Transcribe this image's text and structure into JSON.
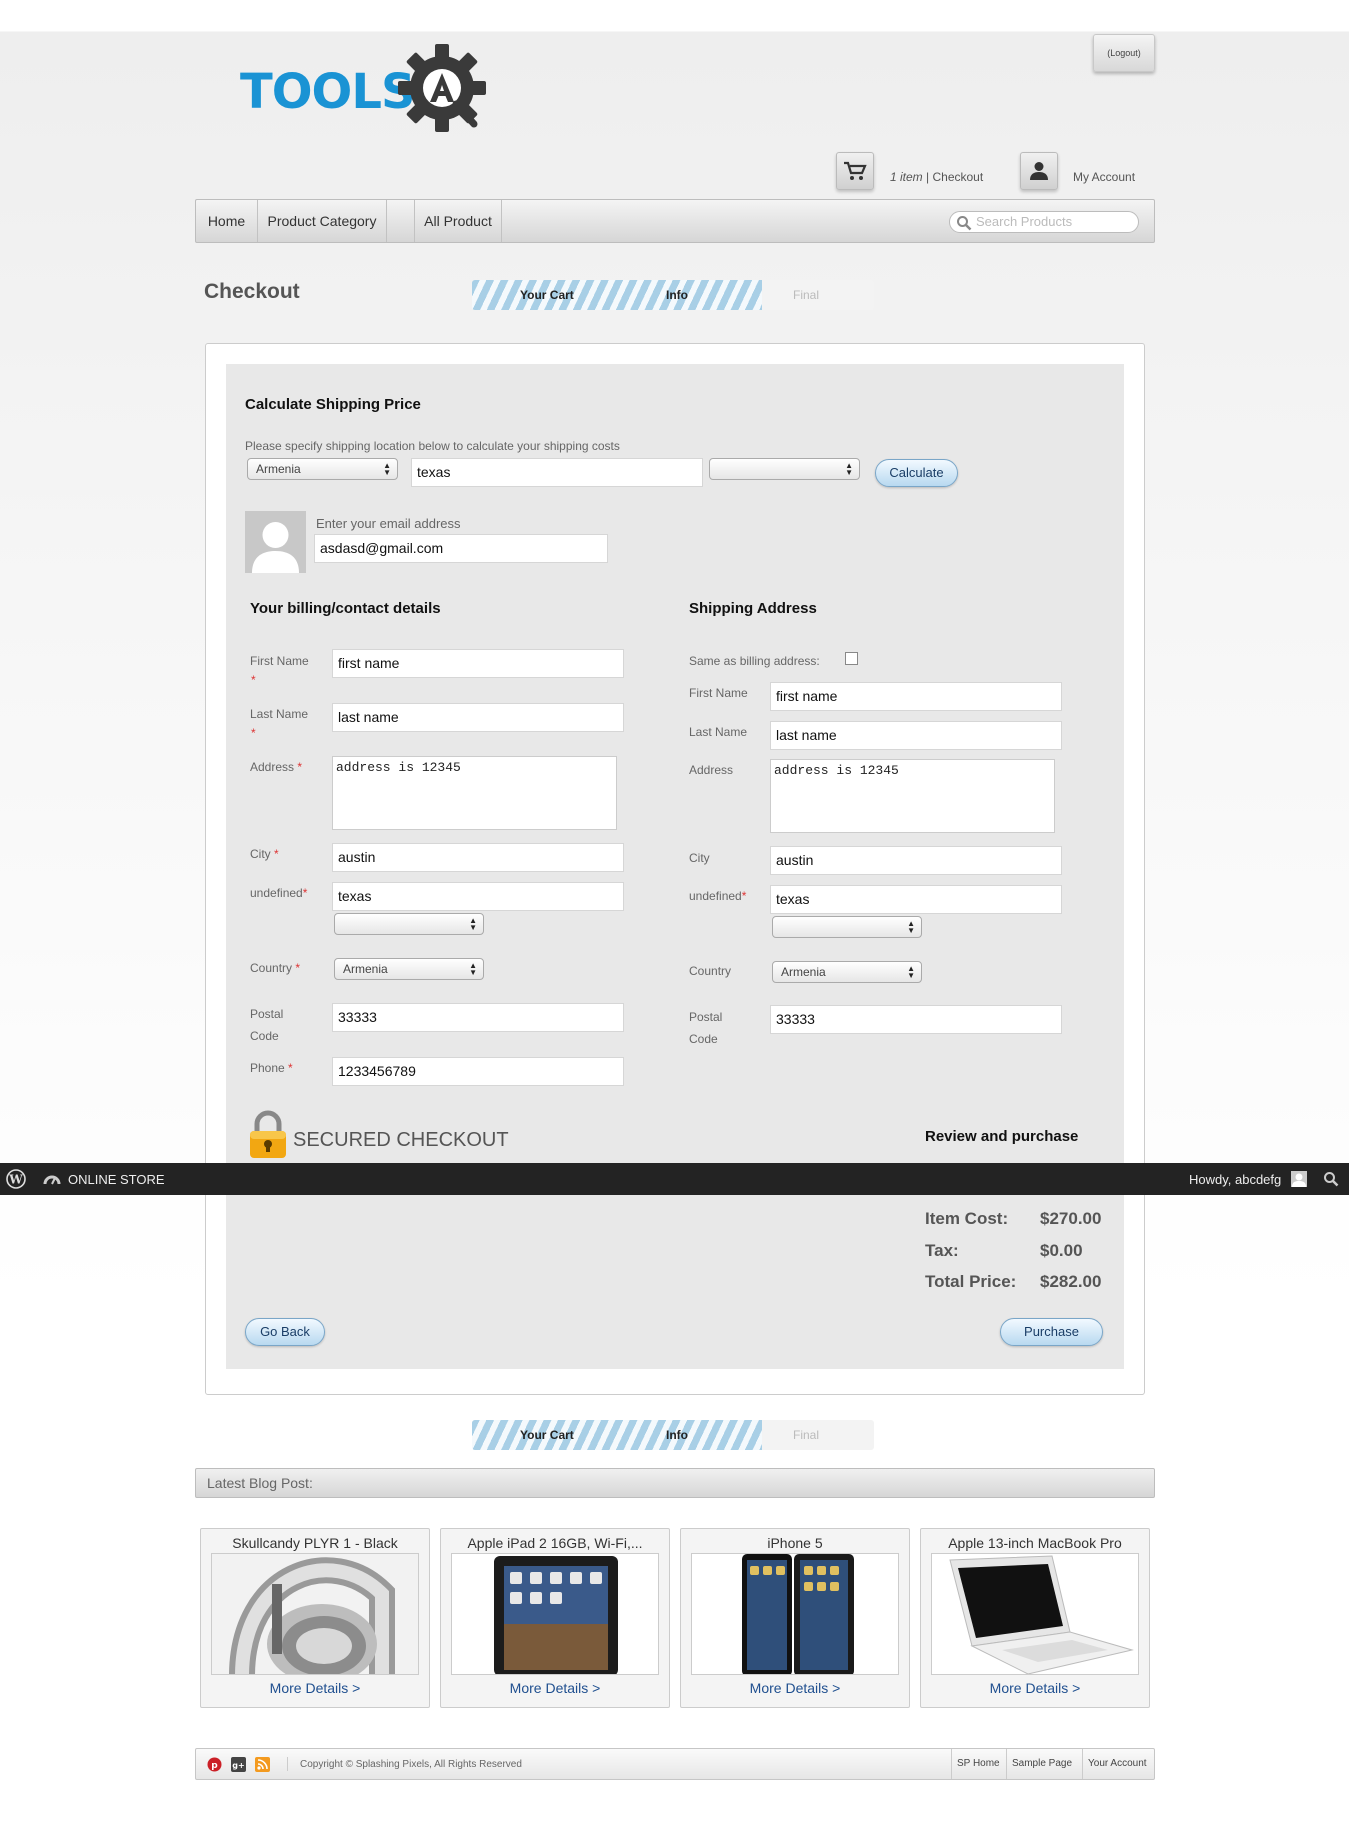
{
  "header": {
    "logo_text": "TOOLS",
    "logout_label": "(Logout)",
    "cart_count": "1 item",
    "cart_link": " | Checkout",
    "account_label": "My Account"
  },
  "nav": {
    "items": [
      "Home",
      "Product Category",
      "All Product"
    ],
    "search_placeholder": "Search Products"
  },
  "checkout": {
    "title": "Checkout",
    "progress": [
      "Your Cart",
      "Info",
      "Final"
    ]
  },
  "shipping_calc": {
    "title": "Calculate Shipping Price",
    "hint": "Please specify shipping location below to calculate your shipping costs",
    "country": "Armenia",
    "region": "texas",
    "state": "",
    "button": "Calculate"
  },
  "email": {
    "label": "Enter your email address",
    "value": "asdasd@gmail.com"
  },
  "billing": {
    "title": "Your billing/contact details",
    "first_name_label": "First Name",
    "first_name": "first name",
    "last_name_label": "Last Name",
    "last_name": "last name",
    "address_label": "Address",
    "address": "address is 12345",
    "city_label": "City",
    "city": "austin",
    "state_label": "undefined",
    "state": "texas",
    "state_select": "",
    "country_label": "Country",
    "country": "Armenia",
    "postal_label_1": "Postal",
    "postal_label_2": "Code",
    "postal": "33333",
    "phone_label": "Phone",
    "phone": "1233456789",
    "required_mark": "*"
  },
  "shipping": {
    "title": "Shipping Address",
    "same_label": "Same as billing address:",
    "first_name_label": "First Name",
    "first_name": "first name",
    "last_name_label": "Last Name",
    "last_name": "last name",
    "address_label": "Address",
    "address": "address is 12345",
    "city_label": "City",
    "city": "austin",
    "state_label": "undefined",
    "state": "texas",
    "state_select": "",
    "country_label": "Country",
    "country": "Armenia",
    "postal_label_1": "Postal",
    "postal_label_2": "Code",
    "postal": "33333"
  },
  "secured": "SECURED CHECKOUT",
  "review": {
    "title": "Review and purchase",
    "item_cost_label": "Item Cost:",
    "item_cost": "$270.00",
    "tax_label": "Tax:",
    "tax": "$0.00",
    "total_label": "Total Price:",
    "total": "$282.00"
  },
  "buttons": {
    "go_back": "Go Back",
    "purchase": "Purchase"
  },
  "wp_admin_bar": {
    "site_name": "ONLINE STORE",
    "greeting": "Howdy, abcdefg"
  },
  "blog": {
    "title": "Latest Blog Post:",
    "products": [
      {
        "name": "Skullcandy PLYR 1 - Black",
        "link": "More Details >"
      },
      {
        "name": "Apple iPad 2 16GB, Wi-Fi,...",
        "link": "More Details >"
      },
      {
        "name": "iPhone 5",
        "link": "More Details >"
      },
      {
        "name": "Apple 13-inch MacBook Pro",
        "link": "More Details >"
      }
    ]
  },
  "footer": {
    "copyright": "Copyright © Splashing Pixels, All Rights Reserved",
    "links": [
      "SP Home",
      "Sample Page",
      "Your Account"
    ]
  },
  "colors": {
    "brand_blue": "#1a93d4",
    "admin_bar": "#232323",
    "link_blue": "#1f4f8f",
    "panel_gray": "#e8e8e8"
  }
}
